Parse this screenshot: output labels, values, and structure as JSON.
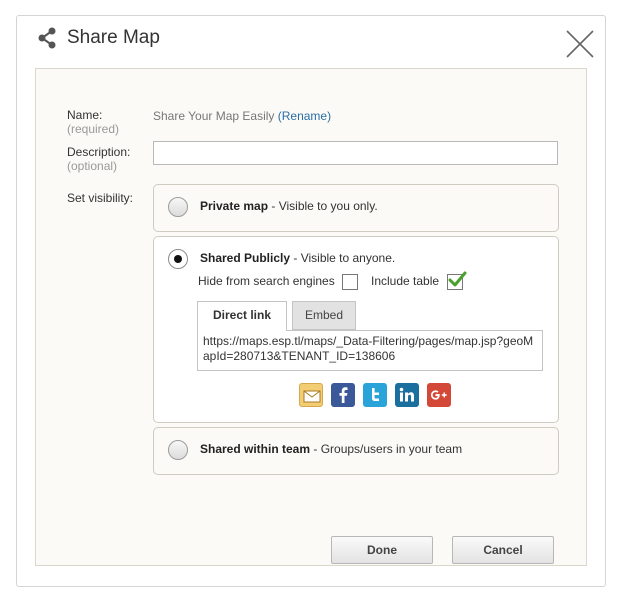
{
  "dialog": {
    "title": "Share Map",
    "icons": {
      "share": "share-icon",
      "close": "close-icon"
    }
  },
  "form": {
    "name_label": "Name:",
    "name_sub": "(required)",
    "name_value": "Share Your Map Easily",
    "rename_link": "(Rename)",
    "description_label": "Description:",
    "description_sub": "(optional)",
    "description_value": "",
    "visibility_label": "Set visibility:"
  },
  "visibility": {
    "private": {
      "title": "Private map",
      "desc": " - Visible to you only.",
      "selected": false
    },
    "public": {
      "title": "Shared Publicly",
      "desc": " - Visible to anyone.",
      "selected": true,
      "hide_search_label": "Hide from search engines",
      "hide_search_checked": false,
      "include_table_label": "Include table",
      "include_table_checked": true,
      "tabs": [
        {
          "label": "Direct link",
          "active": true
        },
        {
          "label": "Embed",
          "active": false
        }
      ],
      "link": "https://maps.esp.tl/maps/_Data-Filtering/pages/map.jsp?geoMapId=280713&TENANT_ID=138606",
      "social": [
        "email-icon",
        "facebook-icon",
        "twitter-icon",
        "linkedin-icon",
        "google-plus-icon"
      ]
    },
    "team": {
      "title": "Shared within team",
      "desc": " - Groups/users in your team",
      "selected": false
    }
  },
  "buttons": {
    "done": "Done",
    "cancel": "Cancel"
  },
  "colors": {
    "panel_bg": "#fbfaf6",
    "link": "#2a6ea8",
    "check": "#49a02c"
  }
}
